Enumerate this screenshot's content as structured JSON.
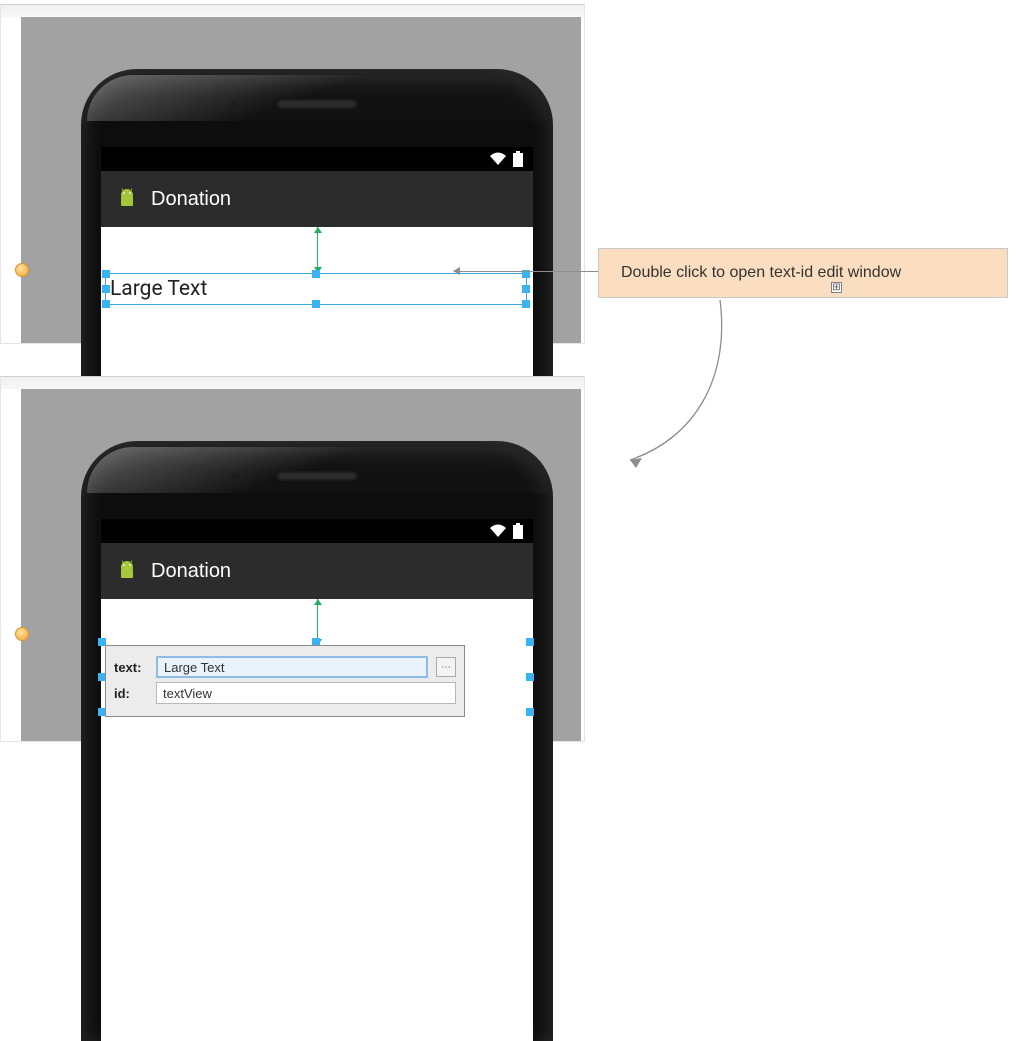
{
  "app": {
    "title": "Donation"
  },
  "widget": {
    "text": "Large Text"
  },
  "popup": {
    "text_label": "text:",
    "text_value": "Large Text",
    "id_label": "id:",
    "id_value": "textView",
    "more_glyph": "⋯"
  },
  "callout": {
    "text": "Double click to open text-id edit window",
    "expand_glyph": "⊞"
  }
}
